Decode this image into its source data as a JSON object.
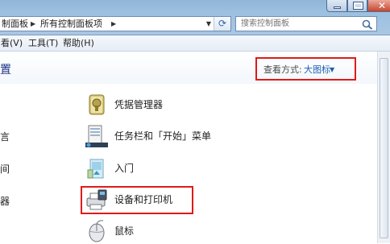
{
  "address": {
    "crumbs": [
      "制面板",
      "所有控制面板项"
    ],
    "refresh_icon": "refresh-icon"
  },
  "search": {
    "placeholder": "搜索控制面板",
    "icon": "search-icon"
  },
  "menu": {
    "items": [
      "看(V)",
      "工具(T)",
      "帮助(H)"
    ]
  },
  "header": {
    "title": "置",
    "view_by_label": "查看方式:",
    "view_by_value": "大图标"
  },
  "left_column": {
    "items": [
      "言",
      "间",
      "器"
    ]
  },
  "items": [
    {
      "label": "凭据管理器",
      "icon": "credential-manager-icon"
    },
    {
      "label": "任务栏和「开始」菜单",
      "icon": "taskbar-start-menu-icon"
    },
    {
      "label": "入门",
      "icon": "getting-started-icon"
    },
    {
      "label": "设备和打印机",
      "icon": "devices-printers-icon"
    },
    {
      "label": "鼠标",
      "icon": "mouse-icon"
    }
  ],
  "colors": {
    "highlight_box": "#e01a1a",
    "link_blue": "#1e5fb4",
    "title_blue": "#1e3287"
  }
}
